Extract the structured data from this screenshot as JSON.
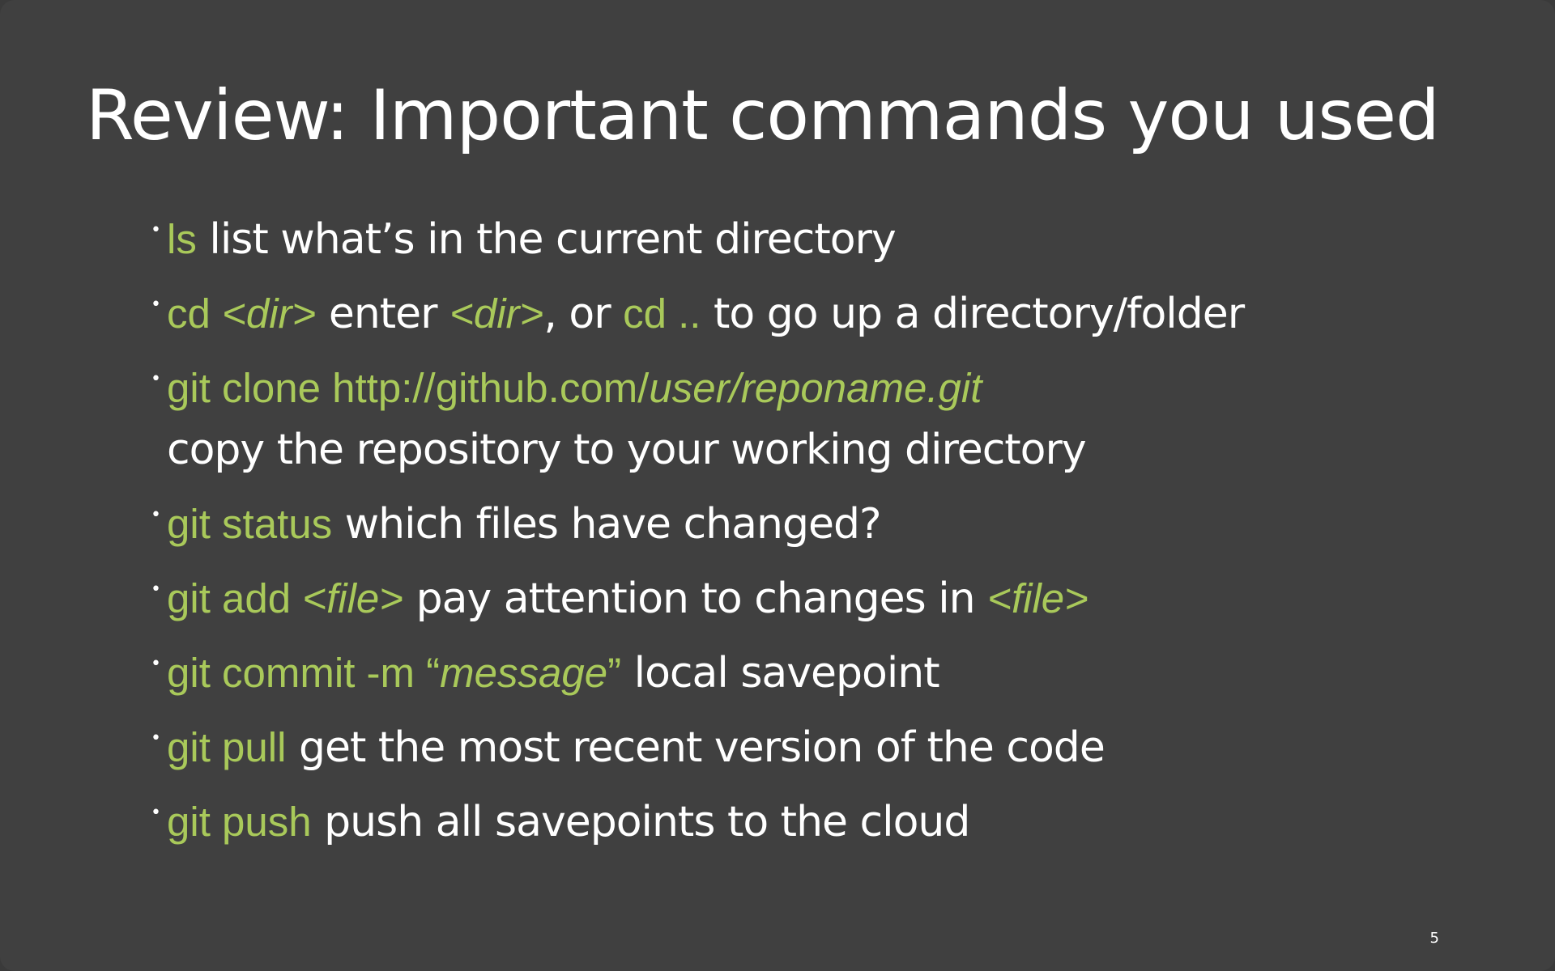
{
  "slide": {
    "title": "Review: Important commands you used",
    "number": "5",
    "bullet_glyph": "•",
    "colors": {
      "background": "#404040",
      "text": "#ffffff",
      "command": "#a9c95a"
    }
  },
  "items": [
    {
      "cmd": "ls",
      "desc": " list what’s in the current directory"
    },
    {
      "cmd": "cd ",
      "arg": "<dir>",
      "desc1": " enter ",
      "arg2": "<dir>",
      "desc2": ", or ",
      "cmd2": "cd ..",
      "desc3": " to go up a directory/folder"
    },
    {
      "cmd": "git clone http://github.com/",
      "arg": "user/reponame.git",
      "desc": "copy the repository to your working directory"
    },
    {
      "cmd": "git status",
      "desc": " which files have changed?"
    },
    {
      "cmd": "git add ",
      "arg": "<file>",
      "desc": " pay attention to changes in ",
      "arg2": "<file>"
    },
    {
      "cmd": "git commit -m “",
      "arg": "message",
      "cmd_end": "”",
      "desc": " local savepoint"
    },
    {
      "cmd": "git pull",
      "desc": " get the most recent version of the code"
    },
    {
      "cmd": "git push",
      "desc": " push all savepoints to the cloud"
    }
  ]
}
